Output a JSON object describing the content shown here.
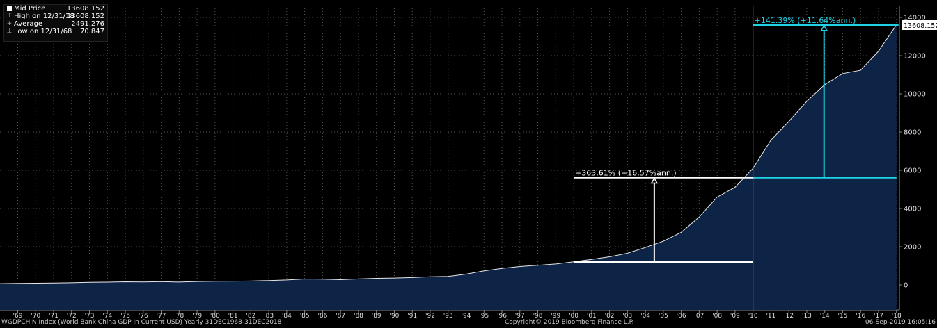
{
  "legend": {
    "mid_label": "Mid Price",
    "mid_value": "13608.152",
    "high_label": "High on 12/31/18",
    "high_value": "13608.152",
    "avg_label": "Average",
    "avg_value": "2491.276",
    "low_label": "Low on 12/31/68",
    "low_value": "70.847"
  },
  "last_price_label": "13608.152",
  "footer": {
    "left": "WGDPCHIN Index (World Bank China GDP in Current USD)  Yearly 31DEC1968-31DEC2018",
    "center": "Copyright© 2019 Bloomberg Finance L.P.",
    "right": "06-Sep-2019 16:05:16"
  },
  "colors": {
    "line": "#e8e8e8",
    "fill": "#0d2447",
    "grid": "#555555",
    "white_annotation": "#ffffff",
    "cyan_annotation": "#1fd3e6",
    "vertical_marker": "#22aa22"
  },
  "chart_data": {
    "type": "area",
    "x": [
      1968,
      1969,
      1970,
      1971,
      1972,
      1973,
      1974,
      1975,
      1976,
      1977,
      1978,
      1979,
      1980,
      1981,
      1982,
      1983,
      1984,
      1985,
      1986,
      1987,
      1988,
      1989,
      1990,
      1991,
      1992,
      1993,
      1994,
      1995,
      1996,
      1997,
      1998,
      1999,
      2000,
      2001,
      2002,
      2003,
      2004,
      2005,
      2006,
      2007,
      2008,
      2009,
      2010,
      2011,
      2012,
      2013,
      2014,
      2015,
      2016,
      2017,
      2018
    ],
    "values": [
      70.847,
      79,
      92,
      100,
      114,
      139,
      144,
      163,
      154,
      175,
      150,
      178,
      191,
      196,
      203,
      228,
      257,
      308,
      298,
      273,
      313,
      347,
      361,
      384,
      429,
      443,
      564,
      734,
      863,
      962,
      1029,
      1094,
      1211,
      1339,
      1471,
      1660,
      1955,
      2286,
      2752,
      3552,
      4598,
      5110,
      6101,
      7573,
      8560,
      9607,
      10480,
      11062,
      11233,
      12238,
      13608.152
    ],
    "x_tick_labels": [
      "'69",
      "'70",
      "'71",
      "'72",
      "'73",
      "'74",
      "'75",
      "'76",
      "'77",
      "'78",
      "'79",
      "'80",
      "'81",
      "'82",
      "'83",
      "'84",
      "'85",
      "'86",
      "'87",
      "'88",
      "'89",
      "'90",
      "'91",
      "'92",
      "'93",
      "'94",
      "'95",
      "'96",
      "'97",
      "'98",
      "'99",
      "'00",
      "'01",
      "'02",
      "'03",
      "'04",
      "'05",
      "'06",
      "'07",
      "'08",
      "'09",
      "'10",
      "'11",
      "'12",
      "'13",
      "'14",
      "'15",
      "'16",
      "'17",
      "'18"
    ],
    "y_ticks": [
      0,
      2000,
      4000,
      6000,
      8000,
      10000,
      12000,
      14000
    ],
    "ylim": [
      -1300,
      14500
    ],
    "grid": true,
    "legend_position": "top-left",
    "annotations": [
      {
        "text": "+363.61% (+16.57%ann.)",
        "color": "white",
        "x_start": 2000,
        "x_end": 2010,
        "y_from": 1211,
        "y_to": 5620,
        "x_label_start": 2000
      },
      {
        "text": "+141.39% (+11.64%ann.)",
        "color": "cyan",
        "x_start": 2010,
        "x_end": 2018,
        "y_from": 5620,
        "y_to": 13608.152
      }
    ],
    "vertical_marker_x": 2010
  }
}
